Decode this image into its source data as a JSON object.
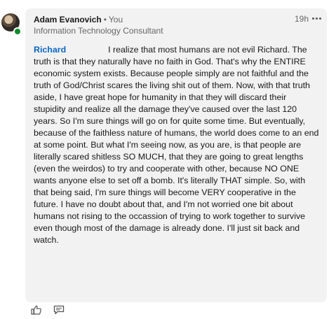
{
  "comment": {
    "author_name": "Adam Evanovich",
    "separator": "•",
    "degree": "You",
    "headline": "Information Technology Consultant",
    "timestamp": "19h",
    "mention": "Richard",
    "body": "I realize that most humans are not evil Richard. The truth is that they naturally have no faith in God.  That's why the ENTIRE economic system exists.  Because people simply are not faithful and the truth of God/Christ scares the living shit out of them.  Now, with that truth aside, I have great hope for humanity in that they will discard their stupidity and realize all the damage they've caused over the last 120 years.  So I'm sure things will go on for quite some time.  But eventually, because of the faithless nature of humans, the world does come to an end at some point.  But what I'm seeing now, as you are, is that people are literally scared shitless SO MUCH, that they are going to great lengths (even the weirdos) to try and cooperate with other, because NO ONE wants anyone else to set off a bomb.  It's literally THAT simple.  So, with that being said, I'm sure things will become VERY cooperative in the future.  I have no doubt about that, and I'm not worried one bit about humans not rising to the occassion of trying to work together to survive even though most of the damage is already done.  I'll just sit back and watch."
  },
  "actions": {
    "like_icon": "thumbs-up-icon",
    "reply_icon": "comment-icon",
    "more_icon": "ellipsis-icon"
  },
  "colors": {
    "mention": "#0a66c2",
    "bubble": "#f2f2f2",
    "presence": "#0a8c2b"
  }
}
